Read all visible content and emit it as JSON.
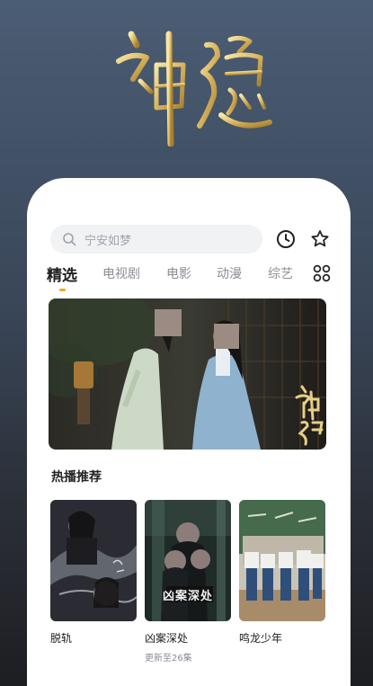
{
  "hero": {
    "logo_text": "神隐"
  },
  "search": {
    "placeholder": "宁安如梦"
  },
  "header_icons": [
    "history-icon",
    "favorite-star-icon"
  ],
  "tabs": [
    {
      "label": "精选",
      "active": true
    },
    {
      "label": "电视剧",
      "active": false
    },
    {
      "label": "电影",
      "active": false
    },
    {
      "label": "动漫",
      "active": false
    },
    {
      "label": "综艺",
      "active": false
    }
  ],
  "banner": {
    "title_art": "神隐"
  },
  "hot": {
    "section_title": "热播推荐",
    "items": [
      {
        "title": "脱轨",
        "subtitle": ""
      },
      {
        "title": "凶案深处",
        "subtitle": "更新至26集",
        "poster_text": "凶案深处"
      },
      {
        "title": "鸣龙少年",
        "subtitle": ""
      }
    ]
  },
  "colors": {
    "accent": "#f3a623",
    "background_top": "#4b5d74",
    "background_bottom": "#1d1e22"
  }
}
